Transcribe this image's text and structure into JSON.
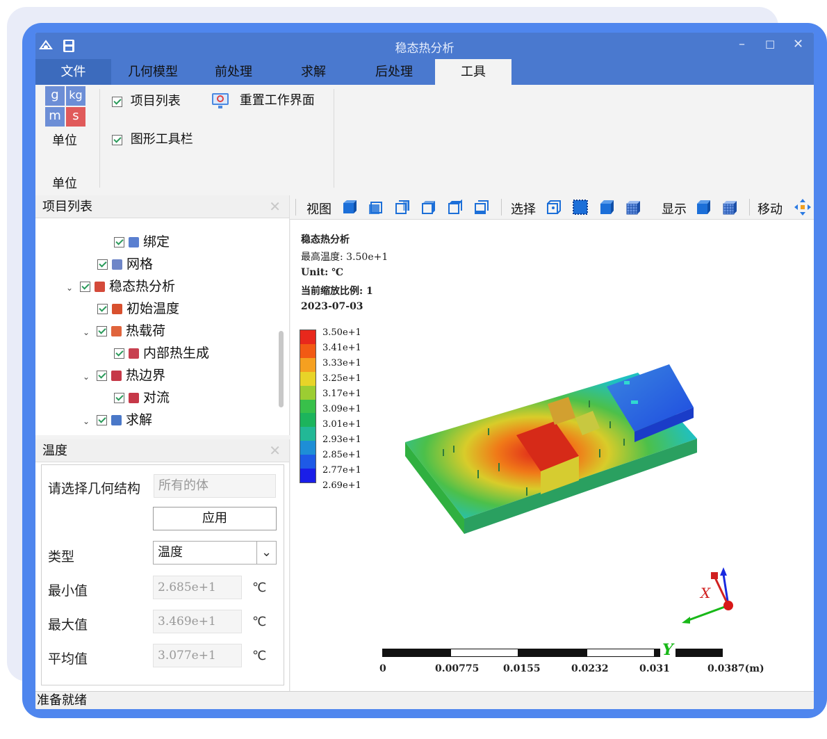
{
  "window": {
    "title": "稳态热分析"
  },
  "tabs": [
    "文件",
    "几何模型",
    "前处理",
    "求解",
    "后处理",
    "工具"
  ],
  "ribbon": {
    "units_icon": [
      "g",
      "kg",
      "m",
      "s"
    ],
    "units_label": "单位",
    "units_group": "单位",
    "project_list": "项目列表",
    "graphics_toolbar": "图形工具栏",
    "reset_ui": "重置工作界面"
  },
  "project_panel": {
    "title": "项目列表",
    "items": [
      "绑定",
      "网格",
      "稳态热分析",
      "初始温度",
      "热载荷",
      "内部热生成",
      "热边界",
      "对流",
      "求解"
    ]
  },
  "props_panel": {
    "title": "温度",
    "select_geometry_label": "请选择几何结构",
    "select_geometry_value": "所有的体",
    "apply_button": "应用",
    "type_label": "类型",
    "type_value": "温度",
    "min_label": "最小值",
    "min_value": "2.685e+1",
    "max_label": "最大值",
    "max_value": "3.469e+1",
    "avg_label": "平均值",
    "avg_value": "3.077e+1",
    "unit": "℃"
  },
  "toolbar": {
    "view": "视图",
    "select": "选择",
    "display": "显示",
    "move": "移动"
  },
  "viewport": {
    "info": [
      "稳态热分析",
      "最高温度: 3.50e+1",
      "Unit: ℃",
      "当前缩放比例: 1",
      "2023-07-03"
    ],
    "colorbar": [
      "3.50e+1",
      "3.41e+1",
      "3.33e+1",
      "3.25e+1",
      "3.17e+1",
      "3.09e+1",
      "3.01e+1",
      "2.93e+1",
      "2.85e+1",
      "2.77e+1",
      "2.69e+1"
    ],
    "colorbar_colors": [
      "#e8281c",
      "#f25a14",
      "#f5a020",
      "#e8d428",
      "#9ccd32",
      "#38c04a",
      "#1cb45c",
      "#22b896",
      "#1e8ed6",
      "#1e5ae6",
      "#1a1ee8"
    ],
    "scale_ticks": [
      "0",
      "0.00775",
      "0.0155",
      "0.0232",
      "0.031",
      "0.0387(m)"
    ],
    "axis_x": "X",
    "axis_y": "Y"
  },
  "status": "准备就绪"
}
